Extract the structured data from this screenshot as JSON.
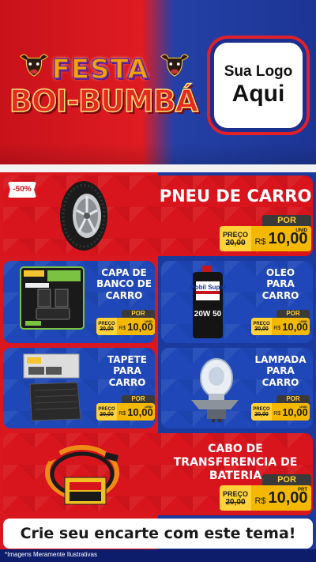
{
  "header": {
    "festa": "FESTA",
    "boi_bumba": "BOI-BUMBÁ",
    "logo_line1": "Sua Logo",
    "logo_line2": "Aqui"
  },
  "colors": {
    "red": "#d8141c",
    "blue": "#1f47b8",
    "price_yellow": "#f5b800",
    "dark_navy": "#0d1d6b"
  },
  "products": [
    {
      "name": "PNEU DE CARRO",
      "badge": "-50%",
      "por": "POR",
      "preco_label": "PREÇO",
      "old_price": "20,00",
      "currency": "R$",
      "price": "10,00",
      "unit": "UNID",
      "image": "tire-icon"
    },
    {
      "name": "CAPA DE BANCO DE CARRO",
      "por": "POR",
      "preco_label": "PREÇO",
      "old_price": "20,00",
      "currency": "R$",
      "price": "10,00",
      "unit": "UNID",
      "image": "seat-cover-icon"
    },
    {
      "name": "OLEO PARA CARRO",
      "por": "POR",
      "preco_label": "PREÇO",
      "old_price": "20,00",
      "currency": "R$",
      "price": "10,00",
      "unit": "UNID",
      "image": "oil-bottle-icon",
      "product_brand": "Mobil Super",
      "product_grade": "20W 50"
    },
    {
      "name": "TAPETE PARA CARRO",
      "por": "POR",
      "preco_label": "PREÇO",
      "old_price": "20,00",
      "currency": "R$",
      "price": "10,00",
      "unit": "UNID",
      "image": "floor-mat-icon"
    },
    {
      "name": "LAMPADA PARA CARRO",
      "por": "POR",
      "preco_label": "PREÇO",
      "old_price": "20,00",
      "currency": "R$",
      "price": "10,00",
      "unit": "UNID",
      "image": "headlight-bulb-icon"
    },
    {
      "name": "CABO DE TRANSFERENCIA DE BATERIA",
      "por": "POR",
      "preco_label": "PREÇO",
      "old_price": "20,00",
      "currency": "R$",
      "price": "10,00",
      "unit": "PRT",
      "image": "jumper-cable-icon"
    }
  ],
  "cta": "Crie seu encarte com este tema!",
  "footnote": "*Imagens Meramente Ilustrativas"
}
